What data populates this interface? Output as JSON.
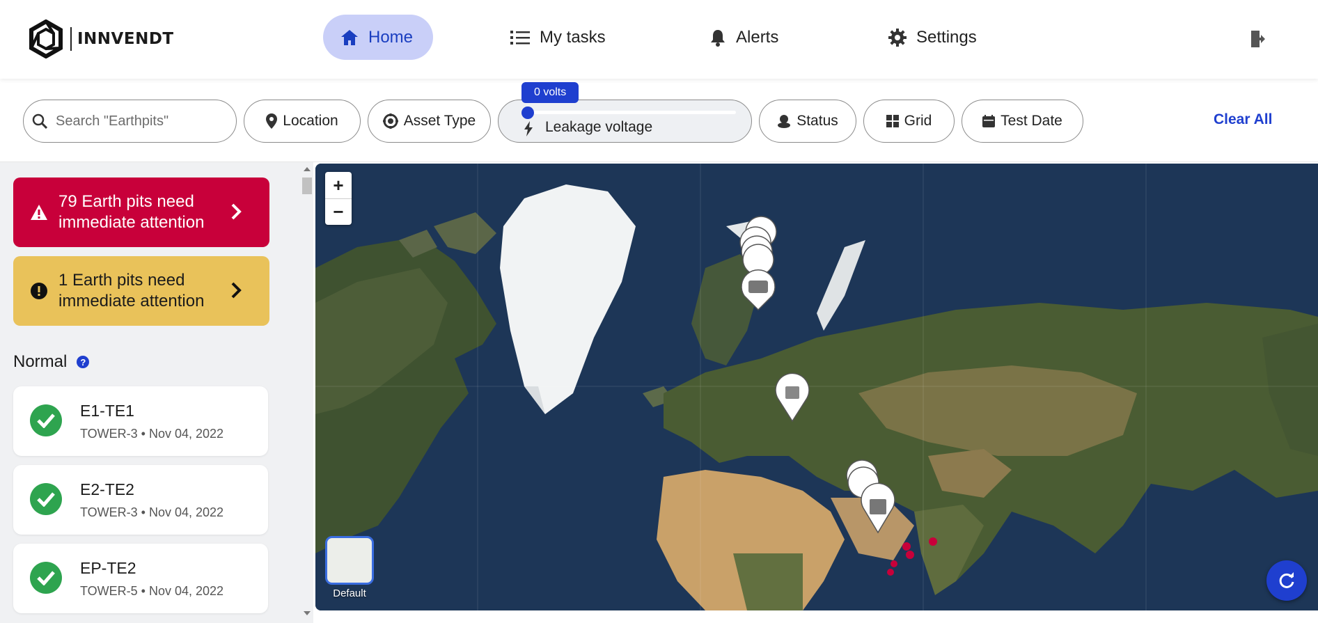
{
  "brand": {
    "name": "INNVENDT"
  },
  "nav": {
    "home": "Home",
    "tasks": "My tasks",
    "alerts": "Alerts",
    "settings": "Settings"
  },
  "filters": {
    "search_placeholder": "Search \"Earthpits\"",
    "location": "Location",
    "asset_type": "Asset Type",
    "slider_value": "0 volts",
    "slider_label": "Leakage voltage",
    "status": "Status",
    "grid": "Grid",
    "test_date": "Test Date",
    "clear_all": "Clear All"
  },
  "sidebar": {
    "alert_critical": "79 Earth pits need immediate attention",
    "alert_warning": "1 Earth pits need immediate attention",
    "normal_heading": "Normal",
    "help_symbol": "?",
    "pits": [
      {
        "name": "E1-TE1",
        "meta": "TOWER-3 • Nov 04, 2022"
      },
      {
        "name": "E2-TE2",
        "meta": "TOWER-3 • Nov 04, 2022"
      },
      {
        "name": "EP-TE2",
        "meta": "TOWER-5 • Nov 04, 2022"
      }
    ]
  },
  "map": {
    "zoom_in": "+",
    "zoom_out": "−",
    "basemap_label": "Default"
  },
  "colors": {
    "accent": "#1f3fcf",
    "home_active_bg": "#c9cff8",
    "critical": "#c8003a",
    "warning": "#e9c25a",
    "ok": "#2ea44f"
  }
}
